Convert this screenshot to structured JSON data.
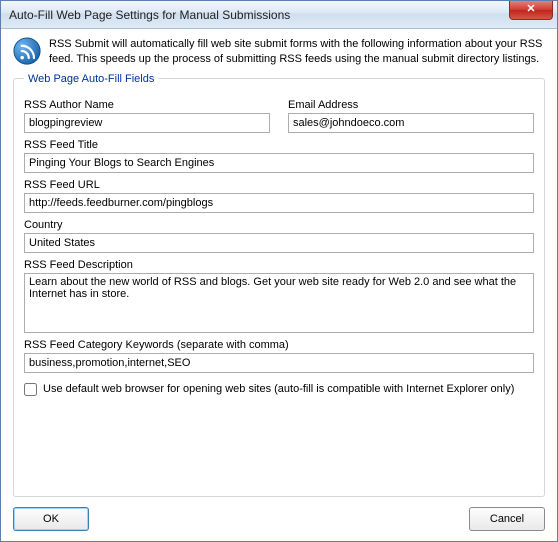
{
  "window": {
    "title": "Auto-Fill Web Page Settings for Manual Submissions",
    "close_glyph": "✕"
  },
  "intro": "RSS Submit will automatically fill web site submit forms with the following information about your RSS feed. This speeds up the process of submitting RSS feeds using the manual submit directory listings.",
  "group": {
    "legend": "Web Page Auto-Fill Fields"
  },
  "labels": {
    "author": "RSS Author Name",
    "email": "Email Address",
    "feed_title": "RSS Feed Title",
    "feed_url": "RSS Feed URL",
    "country": "Country",
    "description": "RSS Feed Description",
    "keywords": "RSS Feed Category Keywords (separate with comma)"
  },
  "values": {
    "author": "blogpingreview",
    "email": "sales@johndoeco.com",
    "feed_title": "Pinging Your Blogs to Search Engines",
    "feed_url": "http://feeds.feedburner.com/pingblogs",
    "country": "United States",
    "description": "Learn about the new world of RSS and blogs. Get your web site ready for Web 2.0 and see what the Internet has in store.",
    "keywords": "business,promotion,internet,SEO"
  },
  "checkbox": {
    "checked": false,
    "label": "Use default web browser for opening web sites (auto-fill is compatible with Internet Explorer only)"
  },
  "buttons": {
    "ok": "OK",
    "cancel": "Cancel"
  }
}
